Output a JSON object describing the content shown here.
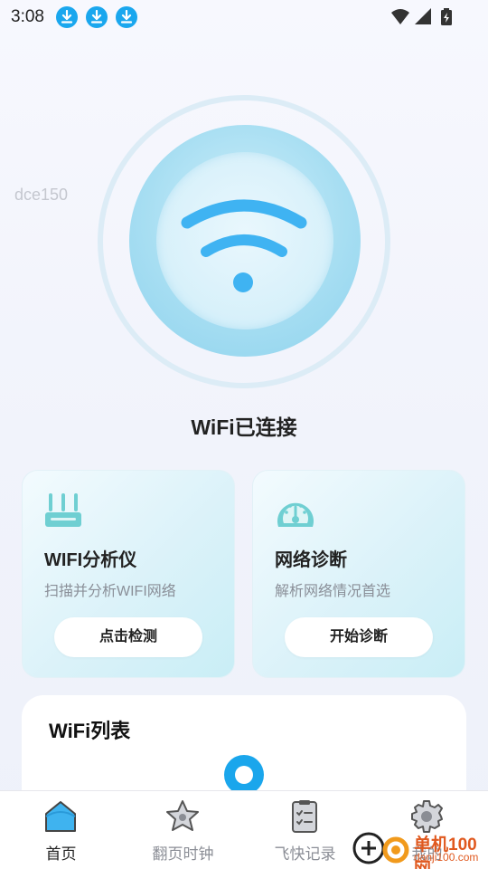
{
  "status_bar": {
    "time": "3:08",
    "notification_icons": [
      "download-icon",
      "download-icon",
      "download-icon"
    ],
    "right_icons": [
      "wifi-signal-icon",
      "cell-signal-icon",
      "battery-charging-icon"
    ]
  },
  "hero": {
    "device_id": "dce150",
    "status": "WiFi已连接",
    "icon": "wifi-icon",
    "accent": "#4bb8f3"
  },
  "cards": [
    {
      "icon": "router-icon",
      "title": "WIFI分析仪",
      "desc": "扫描并分析WIFI网络",
      "button": "点击检测"
    },
    {
      "icon": "speedometer-icon",
      "title": "网络诊断",
      "desc": "解析网络情况首选",
      "button": "开始诊断"
    }
  ],
  "wifi_list": {
    "title": "WiFi列表",
    "loader_color": "#1aa6ec"
  },
  "tabs": [
    {
      "label": "首页",
      "icon": "home-icon",
      "active": true
    },
    {
      "label": "翻页时钟",
      "icon": "star-icon",
      "active": false
    },
    {
      "label": "飞快记录",
      "icon": "checklist-icon",
      "active": false
    },
    {
      "label": "我的",
      "icon": "gear-icon",
      "active": false
    }
  ],
  "watermark": {
    "line1": "单机100网",
    "line2": "danji100.com"
  },
  "colors": {
    "primary": "#1aa7ee",
    "card_icon": "#6fcfd2",
    "tab_active": "#3fb3ef"
  }
}
